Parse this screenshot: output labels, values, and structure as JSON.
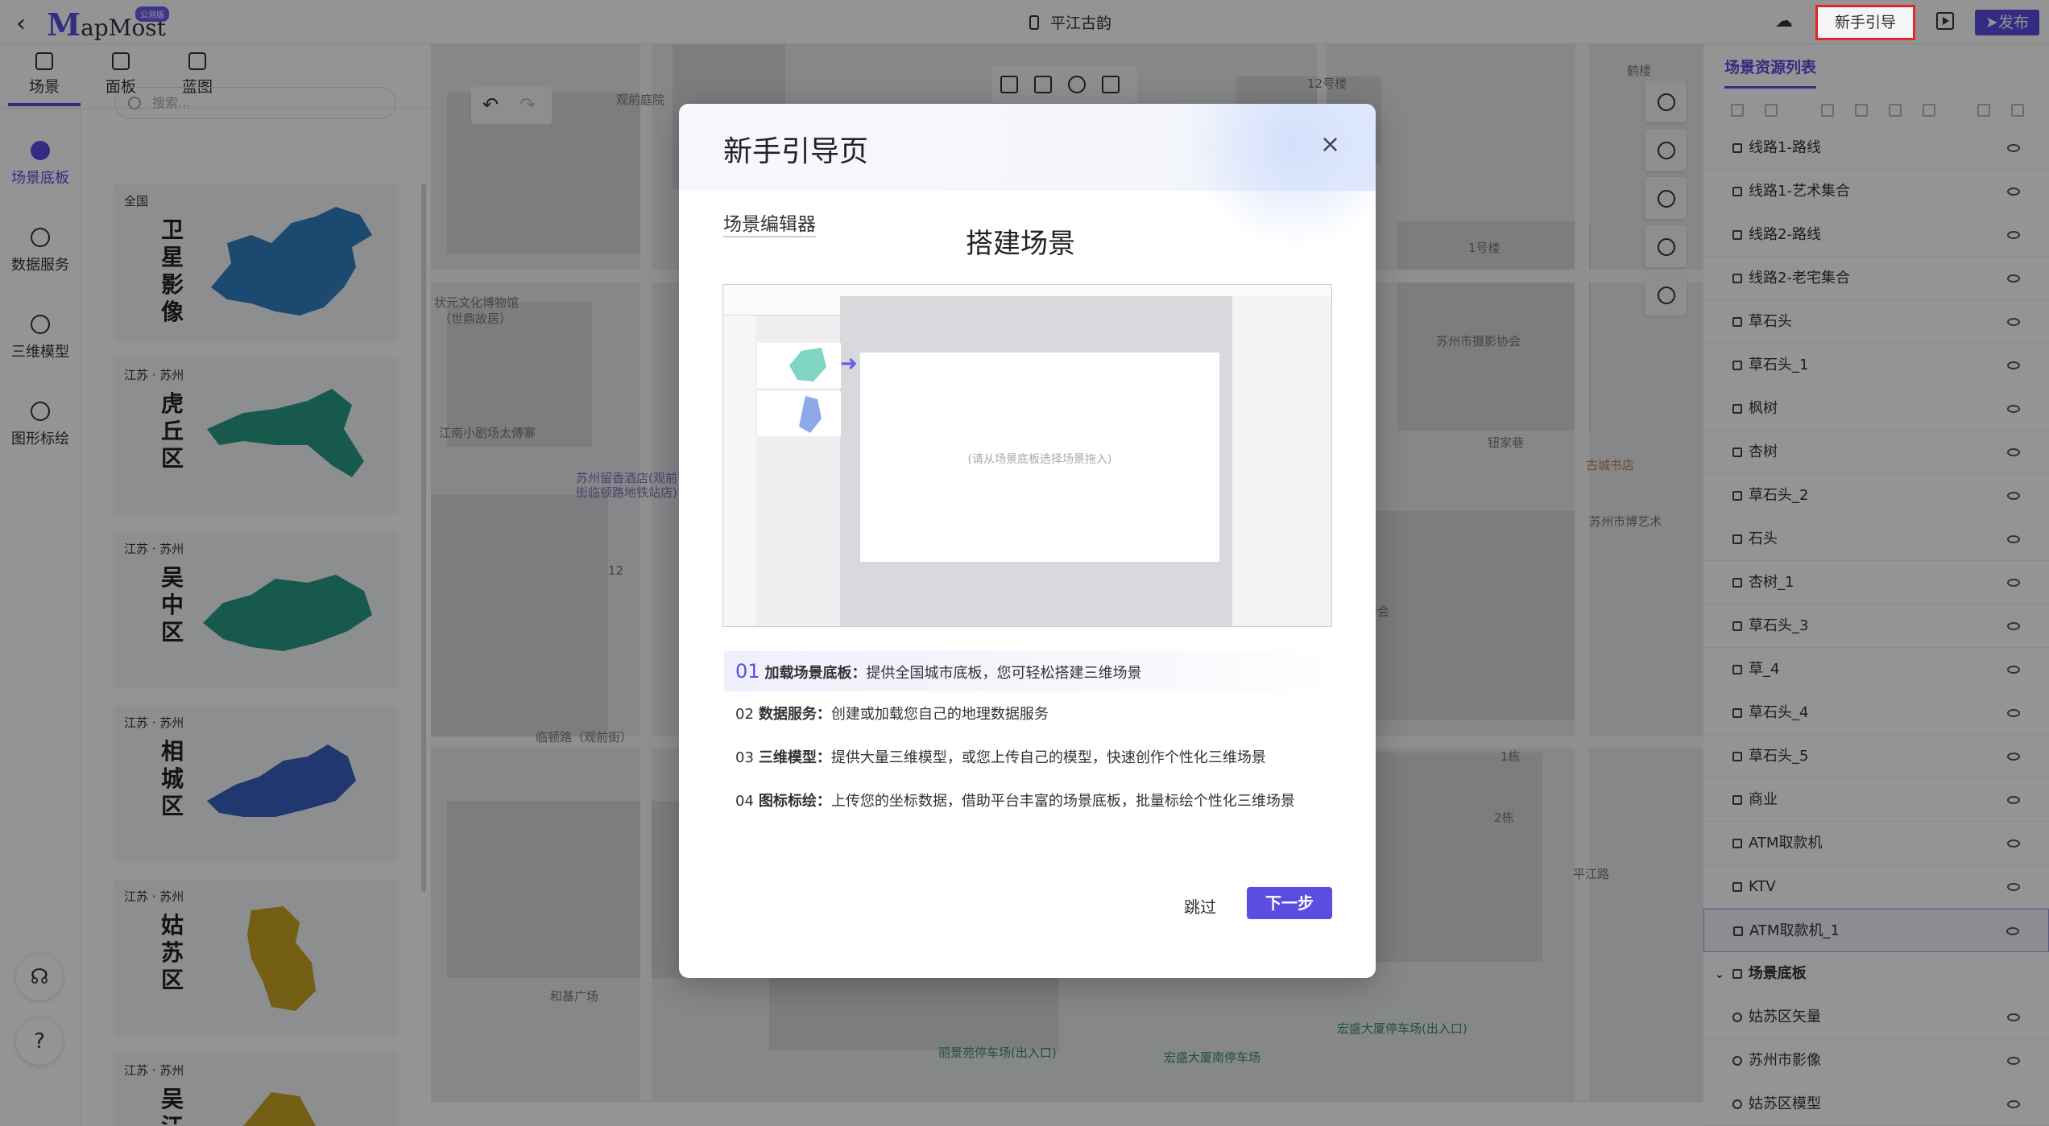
{
  "header": {
    "back_glyph": "‹",
    "logo_m": "M",
    "logo_rest": "apMost",
    "logo_badge": "公测版",
    "project_title": "平江古韵",
    "guide_button": "新手引导",
    "publish_button": "发布"
  },
  "left_tabs": [
    {
      "label": "场景",
      "icon": "scene-icon",
      "active": true
    },
    {
      "label": "面板",
      "icon": "panel-icon",
      "active": false
    },
    {
      "label": "蓝图",
      "icon": "blueprint-icon",
      "active": false
    }
  ],
  "left_nav": [
    {
      "label": "场景底板",
      "icon": "basemap-icon",
      "active": true
    },
    {
      "label": "数据服务",
      "icon": "database-icon",
      "active": false
    },
    {
      "label": "三维模型",
      "icon": "cube-icon",
      "active": false
    },
    {
      "label": "图形标绘",
      "icon": "draw-icon",
      "active": false
    }
  ],
  "search": {
    "placeholder": "搜索..."
  },
  "cards": [
    {
      "region": "全国",
      "name": "卫星影像",
      "color": "#2f7fc1"
    },
    {
      "region": "江苏 · 苏州",
      "name": "虎丘区",
      "color": "#2a9a86"
    },
    {
      "region": "江苏 · 苏州",
      "name": "吴中区",
      "color": "#2a9a86"
    },
    {
      "region": "江苏 · 苏州",
      "name": "相城区",
      "color": "#3a5fc0"
    },
    {
      "region": "江苏 · 苏州",
      "name": "姑苏区",
      "color": "#c9a321"
    },
    {
      "region": "江苏 · 苏州",
      "name": "吴江区",
      "color": "#c9a321"
    }
  ],
  "map_labels": [
    "观前庭院",
    "12号楼",
    "鹤楼",
    "状元文化博物馆",
    "（世鼎故居）",
    "苏州留香酒店(观前",
    "街临顿路地铁站店)",
    "江南小剧场太傅寨",
    "苏州市摄影协会",
    "钮家巷",
    "古城书店",
    "苏州市博艺术",
    "临顿路（观前街）",
    "和基广场",
    "宏盛大厦停车场(出入口)",
    "丽景苑停车场(出入口)",
    "宏盛大厦南停车场",
    "12",
    "平江路",
    "1号楼",
    "1栋",
    "2栋",
    "百合会"
  ],
  "right_panel": {
    "title": "场景资源列表",
    "items": [
      {
        "label": "线路1-路线",
        "icon": "route-icon"
      },
      {
        "label": "线路1-艺术集合",
        "icon": "point-icon"
      },
      {
        "label": "线路2-路线",
        "icon": "route-icon"
      },
      {
        "label": "线路2-老宅集合",
        "icon": "point-icon"
      },
      {
        "label": "草石头",
        "icon": "model-icon"
      },
      {
        "label": "草石头_1",
        "icon": "model-icon"
      },
      {
        "label": "枫树",
        "icon": "model-icon"
      },
      {
        "label": "杏树",
        "icon": "model-icon"
      },
      {
        "label": "草石头_2",
        "icon": "model-icon"
      },
      {
        "label": "石头",
        "icon": "model-icon"
      },
      {
        "label": "杏树_1",
        "icon": "model-icon"
      },
      {
        "label": "草石头_3",
        "icon": "model-icon"
      },
      {
        "label": "草_4",
        "icon": "model-icon"
      },
      {
        "label": "草石头_4",
        "icon": "model-icon"
      },
      {
        "label": "草石头_5",
        "icon": "model-icon"
      },
      {
        "label": "商业",
        "icon": "building-icon"
      },
      {
        "label": "ATM取款机",
        "icon": "point-icon"
      },
      {
        "label": "KTV",
        "icon": "point-icon"
      },
      {
        "label": "ATM取款机_1",
        "icon": "point-icon",
        "selected": true
      }
    ],
    "group": {
      "label": "场景底板",
      "icon": "folder-icon"
    },
    "group_items": [
      {
        "label": "姑苏区矢量",
        "icon": "globe-icon"
      },
      {
        "label": "苏州市影像",
        "icon": "globe-icon"
      },
      {
        "label": "姑苏区模型",
        "icon": "globe-icon"
      }
    ]
  },
  "modal": {
    "title": "新手引导页",
    "close_glyph": "×",
    "editor_label": "场景编辑器",
    "step_heading": "搭建场景",
    "preview_hint": "(请从场景底板选择场景拖入)",
    "steps": [
      {
        "num": "01",
        "title": "加载场景底板：",
        "desc": "提供全国城市底板，您可轻松搭建三维场景",
        "active": true
      },
      {
        "num": "02",
        "title": "数据服务：",
        "desc": "创建或加载您自己的地理数据服务",
        "active": false
      },
      {
        "num": "03",
        "title": "三维模型：",
        "desc": "提供大量三维模型，或您上传自己的模型，快速创作个性化三维场景",
        "active": false
      },
      {
        "num": "04",
        "title": "图标标绘：",
        "desc": "上传您的坐标数据，借助平台丰富的场景底板，批量标绘个性化三维场景",
        "active": false
      }
    ],
    "skip_button": "跳过",
    "next_button": "下一步"
  },
  "colors": {
    "accent": "#5b4de0",
    "highlight_border": "#e4252a"
  }
}
